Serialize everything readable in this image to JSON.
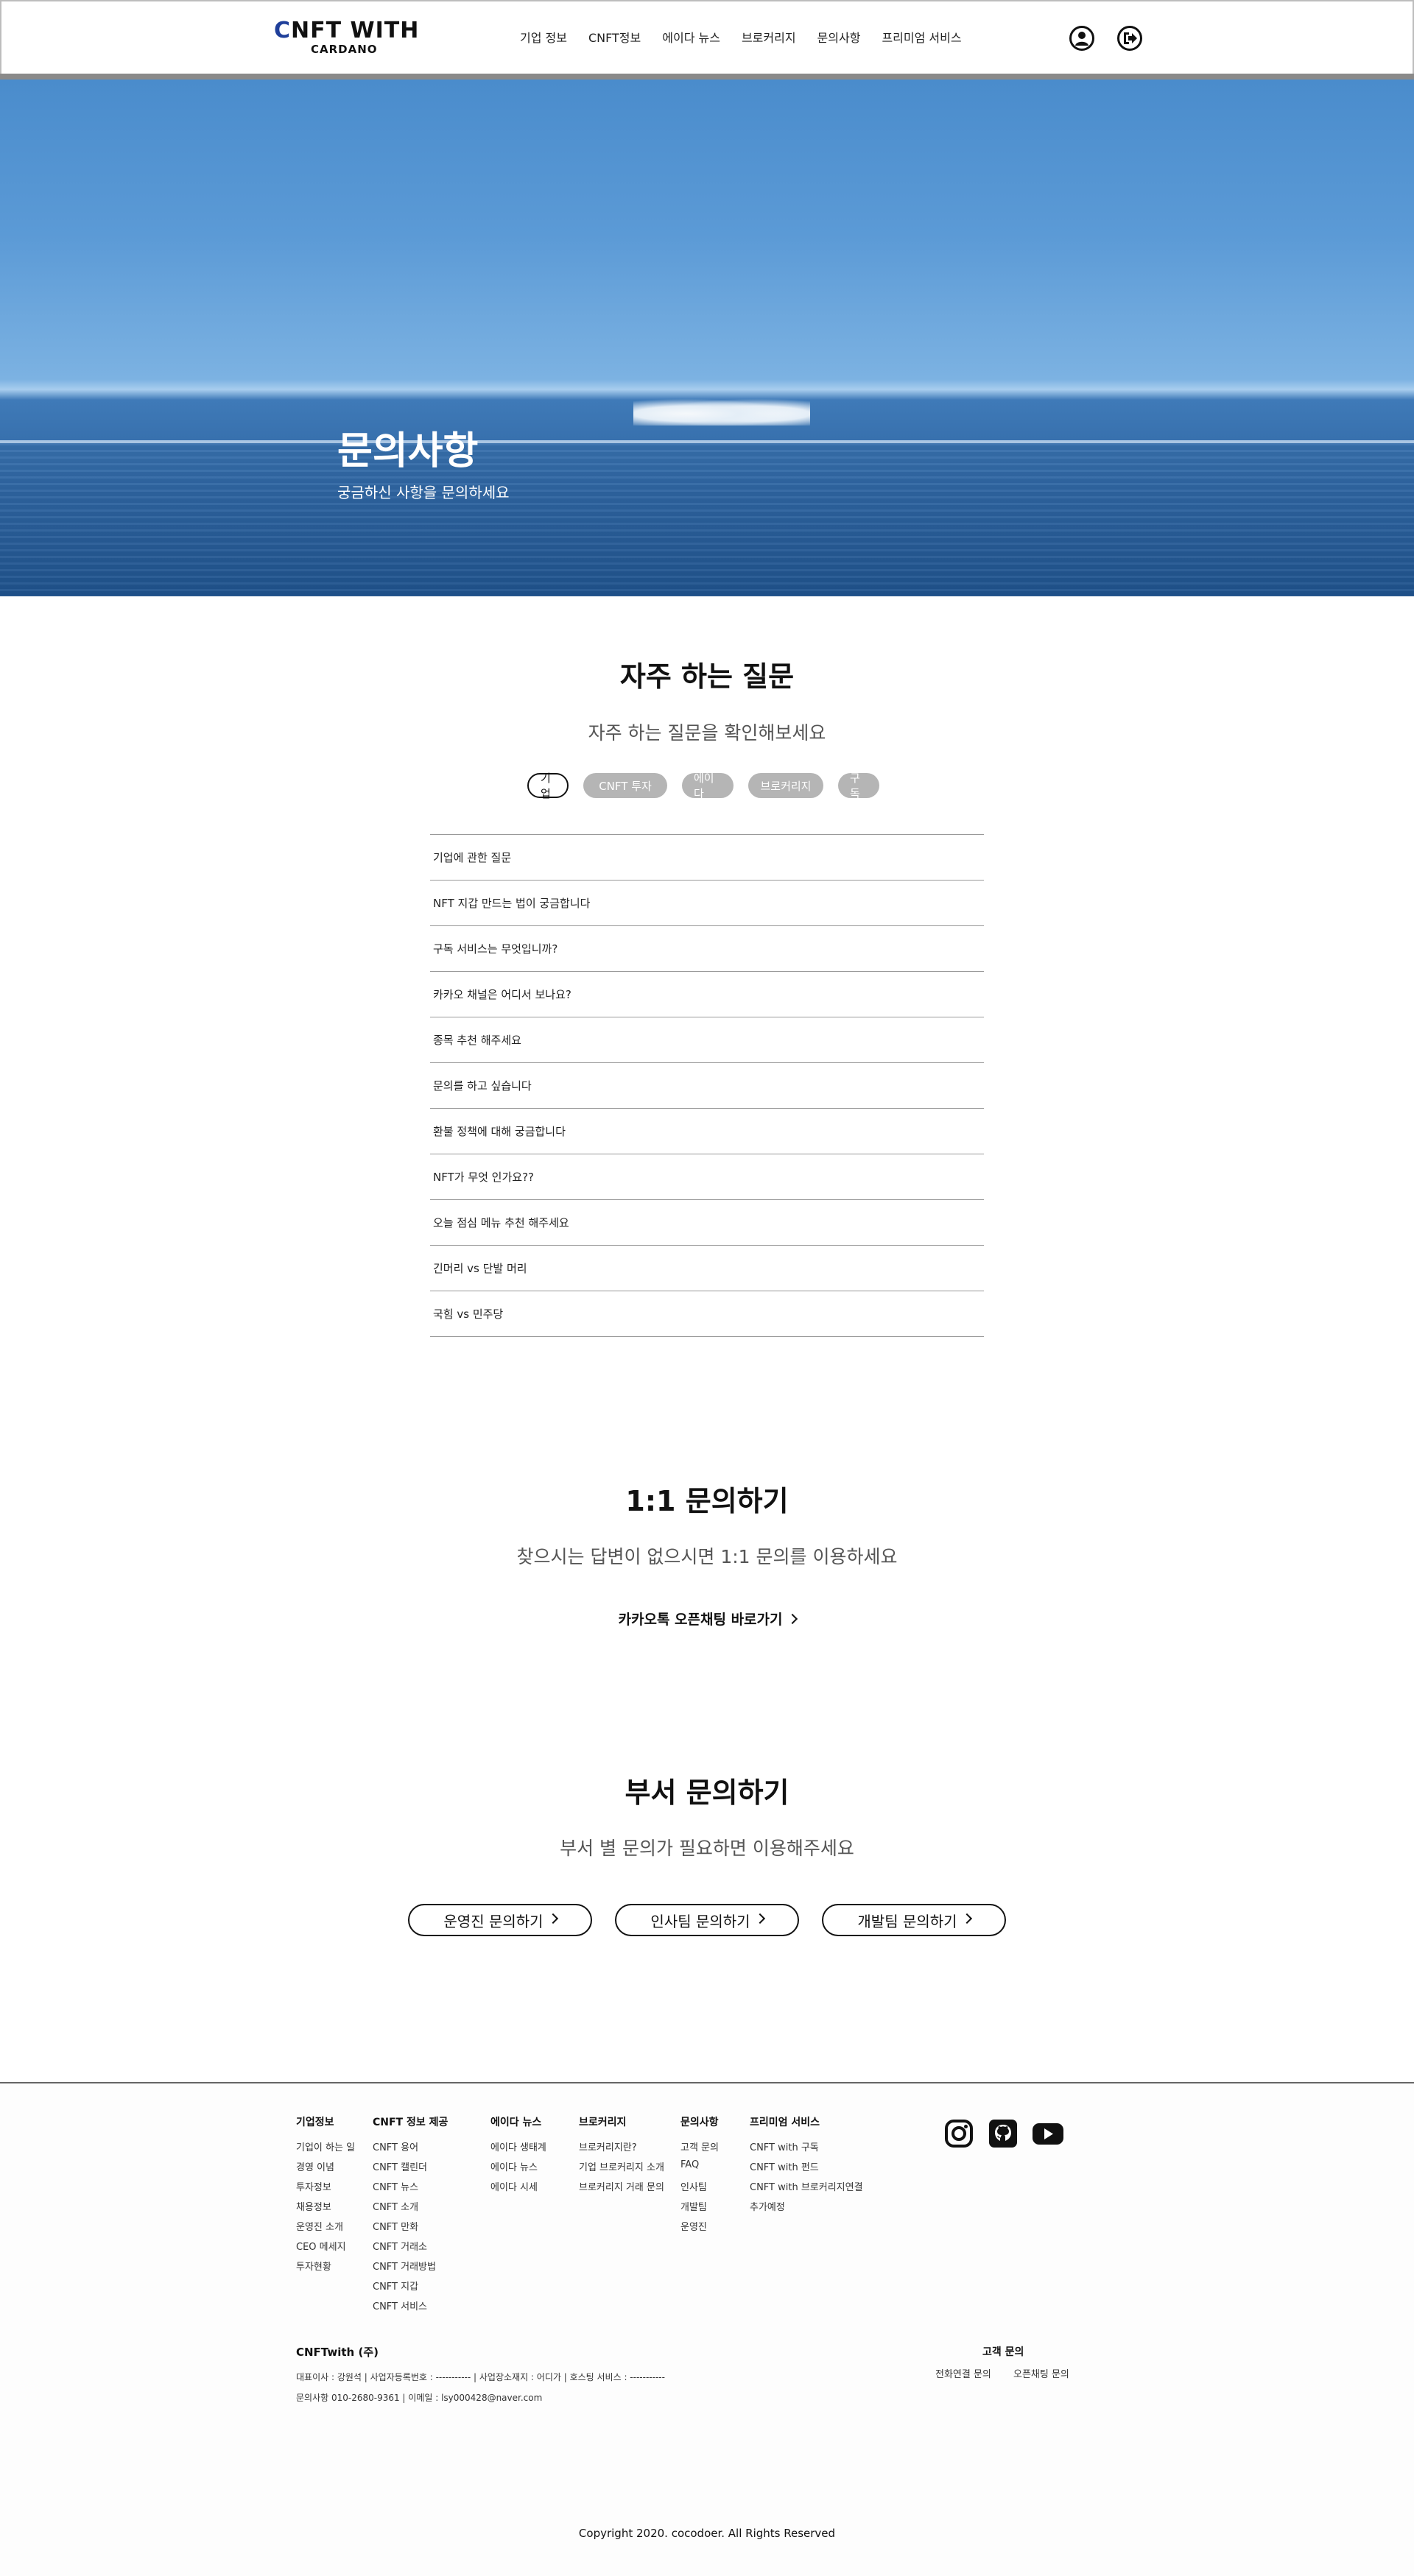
{
  "header": {
    "logo_main": "CNFT WITH",
    "logo_sub": "CARDANO",
    "nav": [
      "기업 정보",
      "CNFT정보",
      "에이다 뉴스",
      "브로커리지",
      "문의사항",
      "프리미엄 서비스"
    ],
    "icons": [
      "user-icon",
      "logout-icon"
    ]
  },
  "hero": {
    "title": "문의사항",
    "subtitle": "궁금하신 사항을 문의하세요"
  },
  "faq": {
    "title": "자주 하는 질문",
    "subtitle": "자주 하는 질문을 확인해보세요",
    "tabs": [
      "기업",
      "CNFT 투자",
      "에이다",
      "브로커리지",
      "구독"
    ],
    "active_tab": "기업",
    "items": [
      "기업에 관한 질문",
      "NFT 지갑 만드는 법이 궁금합니다",
      "구독 서비스는 무엇입니까?",
      "카카오 채널은 어디서 보나요?",
      "종목 추천 해주세요",
      "문의를 하고 싶습니다",
      "환불 정책에 대해 궁금합니다",
      "NFT가 무엇 인가요??",
      "오늘 점심 메뉴 추천 해주세요",
      "긴머리 vs 단발 머리",
      "국힘 vs 민주당"
    ]
  },
  "one_on_one": {
    "title": "1:1 문의하기",
    "subtitle": "찾으시는 답변이 없으시면 1:1 문의를 이용하세요",
    "link": "카카오톡 오픈채팅 바로가기"
  },
  "dept": {
    "title": "부서 문의하기",
    "subtitle": "부서 별 문의가 필요하면 이용해주세요",
    "buttons": [
      "운영진 문의하기",
      "인사팀 문의하기",
      "개발팀 문의하기"
    ]
  },
  "footer": {
    "columns": [
      {
        "title": "기업정보",
        "items": [
          "기업이 하는 일",
          "경영 이념",
          "투자정보",
          "채용정보",
          "운영진 소개",
          "CEO 메세지",
          "투자현황"
        ]
      },
      {
        "title": "CNFT 정보 제공",
        "items": [
          "CNFT 용어",
          "CNFT 캘린더",
          "CNFT 뉴스",
          "CNFT 소개",
          "CNFT 만화",
          "CNFT 거래소",
          "CNFT 거래방법",
          "CNFT 지갑",
          "CNFT 서비스"
        ]
      },
      {
        "title": "에이다 뉴스",
        "items": [
          "에이다 생태계",
          "에이다 뉴스",
          "에이다 시세"
        ]
      },
      {
        "title": "브로커리지",
        "items": [
          "브로커리지란?",
          "기업 브로커리지 소개",
          "브로커리지 거래 문의"
        ]
      },
      {
        "title": "문의사항",
        "items": [
          "고객 문의",
          "FAQ",
          "인사팀",
          "개발팀",
          "운영진"
        ]
      },
      {
        "title": "프리미엄 서비스",
        "items": [
          "CNFT with 구독",
          "CNFT with 펀드",
          "CNFT with 브로커리지연결",
          "추가예정"
        ]
      }
    ],
    "social": [
      "instagram-icon",
      "github-icon",
      "youtube-icon"
    ],
    "company_name": "CNFTwith (주)",
    "company_line1": "대표이사 : 강원석   |   사업자등록번호 : -----------   |   사업장소재지 : 어디가   |   호스팅 서비스 : -----------",
    "company_line2": "문의사항  010-2680-9361   |   이메일 : lsy000428@naver.com",
    "support_title": "고객 문의",
    "support_links": [
      "전화연결 문의",
      "오픈채팅 문의"
    ],
    "copyright": "Copyright 2020. cocodoer. All Rights Reserved"
  }
}
